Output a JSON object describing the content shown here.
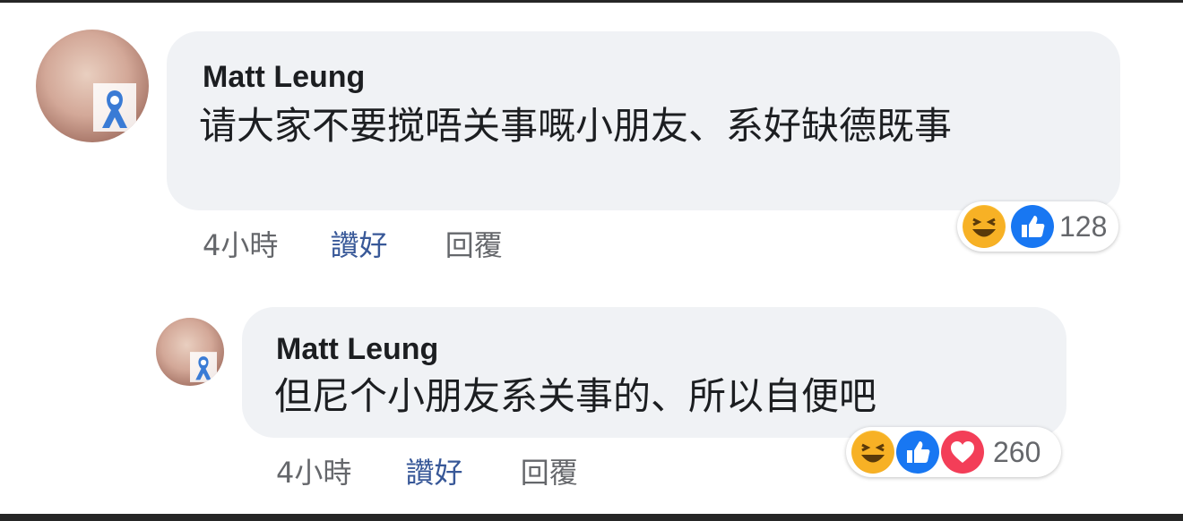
{
  "comments": [
    {
      "author": "Matt Leung",
      "text": "请大家不要搅唔关事嘅小朋友、系好缺德既事",
      "time": "4小時",
      "like_label": "讚好",
      "reply_label": "回覆",
      "reaction_count": "128",
      "reactions": [
        "haha-icon",
        "like-icon"
      ]
    },
    {
      "author": "Matt Leung",
      "text": "但尼个小朋友系关事的、所以自便吧",
      "time": "4小時",
      "like_label": "讚好",
      "reply_label": "回覆",
      "reaction_count": "260",
      "reactions": [
        "haha-icon",
        "like-icon",
        "love-icon"
      ]
    }
  ],
  "colors": {
    "bubble": "#f0f2f5",
    "like_link": "#385898",
    "like_reaction": "#1877f2",
    "love_reaction": "#f33e58"
  }
}
